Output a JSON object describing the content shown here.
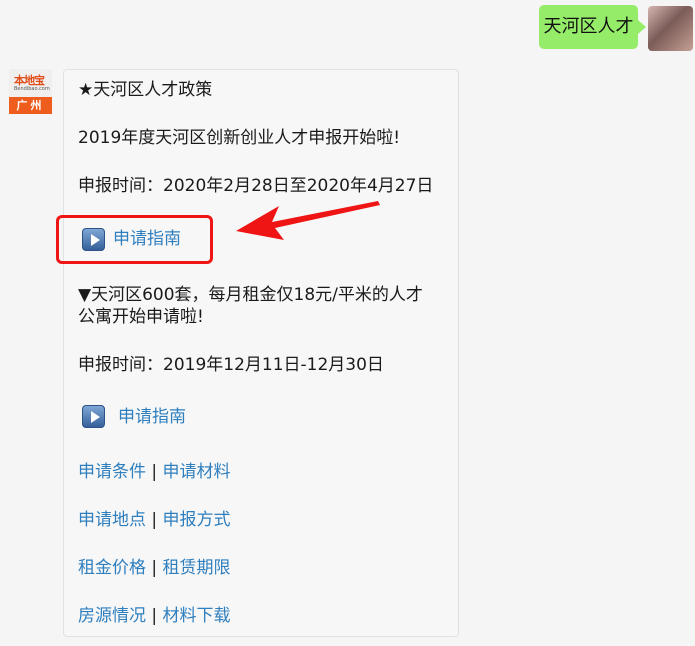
{
  "user_message": {
    "text": "天河区人才"
  },
  "bot": {
    "avatar": {
      "logo": "本地宝",
      "url": "Bendibao.com",
      "city": "广州"
    },
    "card": {
      "policy_title": "★天河区人才政策",
      "section1_line": "2019年度天河区创新创业人才申报开始啦!",
      "section1_time": "申报时间：2020年2月28日至2020年4月27日",
      "section1_link": "申请指南",
      "section2_line1": "▼天河区600套，每月租金仅18元/平米的人才",
      "section2_line2": "公寓开始申请啦!",
      "section2_time": "申报时间：2019年12月11日-12月30日",
      "section2_link": "申请指南",
      "separator": "|",
      "link_rows": [
        {
          "left": "申请条件",
          "right": "申请材料"
        },
        {
          "left": "申请地点",
          "right": "申报方式"
        },
        {
          "left": "租金价格",
          "right": "租赁期限"
        },
        {
          "left": "房源情况",
          "right": "材料下载"
        }
      ]
    }
  },
  "colors": {
    "link": "#2f7fbf",
    "highlight": "#f01515",
    "out_bubble": "#95ec69"
  }
}
